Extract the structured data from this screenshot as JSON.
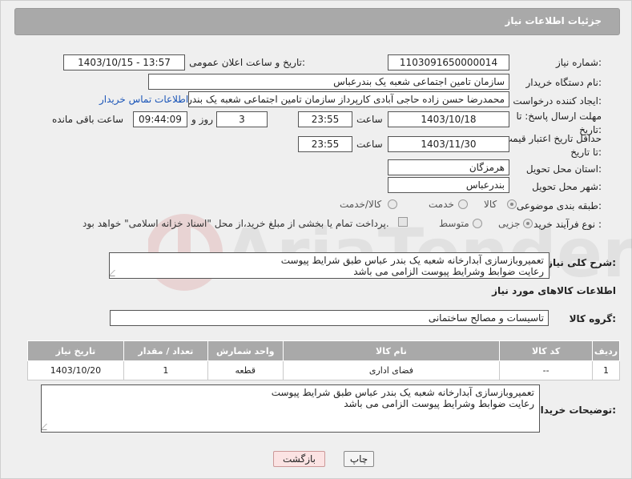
{
  "header": {
    "title": "جزئیات اطلاعات نیاز"
  },
  "fields": {
    "need_number_label": "شماره نیاز:",
    "need_number": "1103091650000014",
    "announce_label": "تاریخ و ساعت اعلان عمومی:",
    "announce_value": "1403/10/15 - 13:57",
    "buyer_org_label": "نام دستگاه خریدار:",
    "buyer_org": "سازمان تامین اجتماعی شعبه یک بندرعباس",
    "creator_label": "ایجاد کننده درخواست:",
    "creator": "محمدرضا حسن زاده حاجی آبادی کارپرداز سازمان تامین اجتماعی شعبه یک بندر",
    "contact_link": "اطلاعات تماس خریدار",
    "deadline_label": "مهلت ارسال پاسخ: تا تاریخ:",
    "deadline_date": "1403/10/18",
    "time_label": "ساعت",
    "deadline_time": "23:55",
    "days_value": "3",
    "days_label": "روز و",
    "remaining_time": "09:44:09",
    "remaining_label": "ساعت باقی مانده",
    "price_valid_label": "حداقل تاریخ اعتبار قیمت: تا تاریخ:",
    "price_valid_date": "1403/11/30",
    "price_valid_time": "23:55",
    "province_label": "استان محل تحویل:",
    "province": "هرمزگان",
    "city_label": "شهر محل تحویل:",
    "city": "بندرعباس",
    "category_label": "طبقه بندی موضوعی:",
    "category_options": [
      "کالا",
      "خدمت",
      "کالا/خدمت"
    ],
    "category_selected": "کالا",
    "process_label": "نوع فرآیند خرید :",
    "process_options": [
      "جزیی",
      "متوسط"
    ],
    "process_selected": "جزیی",
    "payment_note": "پرداخت تمام یا بخشی از مبلغ خرید،از محل \"اسناد خزانه اسلامی\" خواهد بود."
  },
  "description": {
    "label": "شرح کلی نیاز:",
    "line1": "تعمیروبازسازی آبدارخانه شعبه یک بندر عباس طبق شرایط پیوست",
    "line2": "رعایت ضوابط وشرایط پیوست الزامی می باشد"
  },
  "goods": {
    "section_title": "اطلاعات کالاهای مورد نیاز",
    "group_label": "گروه کالا:",
    "group_value": "تاسیسات و مصالح ساختمانی",
    "columns": [
      "ردیف",
      "کد کالا",
      "نام کالا",
      "واحد شمارش",
      "تعداد / مقدار",
      "تاریخ نیاز"
    ],
    "rows": [
      [
        "1",
        "--",
        "فضای اداری",
        "قطعه",
        "1",
        "1403/10/20"
      ]
    ]
  },
  "buyer_notes": {
    "label": "توضیحات خریدار:",
    "line1": "تعمیروبازسازی آبدارخانه شعبه یک بندر عباس طبق شرایط پیوست",
    "line2": "رعایت ضوابط وشرایط پیوست الزامی می باشد"
  },
  "buttons": {
    "print": "چاپ",
    "back": "بازگشت"
  },
  "watermark": {
    "text": "AriaTender.neT"
  }
}
